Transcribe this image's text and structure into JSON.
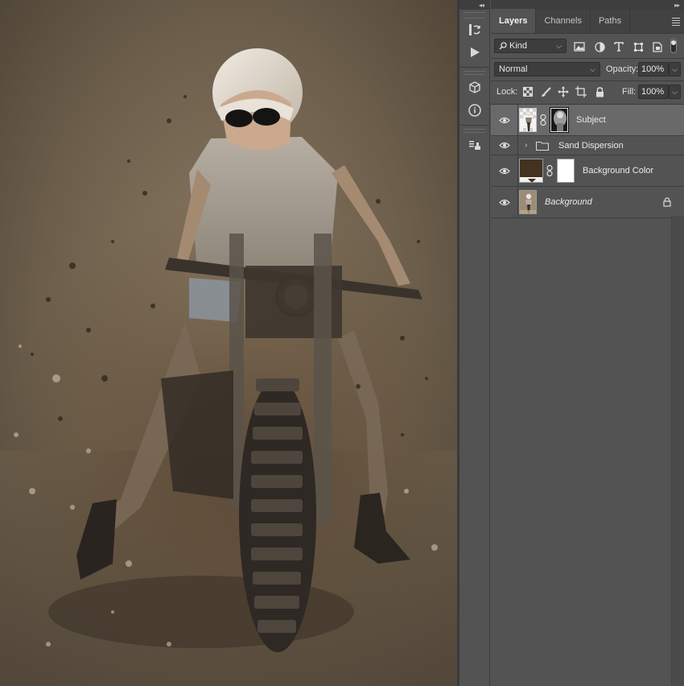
{
  "canvas": {
    "description_icon": "photo-canvas"
  },
  "toolstrip": {
    "collapse_glyph": "◂◂",
    "tools": [
      {
        "icon": "history-icon"
      },
      {
        "icon": "play-actions-icon"
      },
      {
        "icon": "3d-cube-icon"
      },
      {
        "icon": "info-icon"
      },
      {
        "icon": "clone-source-icon"
      }
    ]
  },
  "panel": {
    "collapse_glyph": "▸▸",
    "tabs": [
      {
        "label": "Layers",
        "active": true
      },
      {
        "label": "Channels",
        "active": false
      },
      {
        "label": "Paths",
        "active": false
      }
    ],
    "filter": {
      "kind_label": "Kind",
      "icons": [
        "image-filter-icon",
        "adjustment-filter-icon",
        "type-filter-icon",
        "shape-filter-icon",
        "smart-object-filter-icon",
        "filter-toggle-icon"
      ]
    },
    "blend": {
      "mode": "Normal",
      "opacity_label": "Opacity:",
      "opacity_value": "100%"
    },
    "lock": {
      "label": "Lock:",
      "icons": [
        "lock-transparent-icon",
        "lock-paint-icon",
        "lock-move-icon",
        "lock-artboard-icon",
        "lock-all-icon"
      ],
      "fill_label": "Fill:",
      "fill_value": "100%"
    },
    "layers": [
      {
        "name": "Subject",
        "type": "masked",
        "selected": true,
        "visible": true,
        "italic": false
      },
      {
        "name": "Sand Dispersion",
        "type": "group",
        "selected": false,
        "visible": true,
        "italic": false
      },
      {
        "name": "Background Color",
        "type": "fill",
        "selected": false,
        "visible": true,
        "italic": false
      },
      {
        "name": "Background",
        "type": "background",
        "selected": false,
        "visible": true,
        "italic": true,
        "locked": true
      }
    ]
  },
  "colors": {
    "panel_bg": "#535353",
    "selected_layer": "#696969",
    "fill_swatch": "#43321f"
  }
}
